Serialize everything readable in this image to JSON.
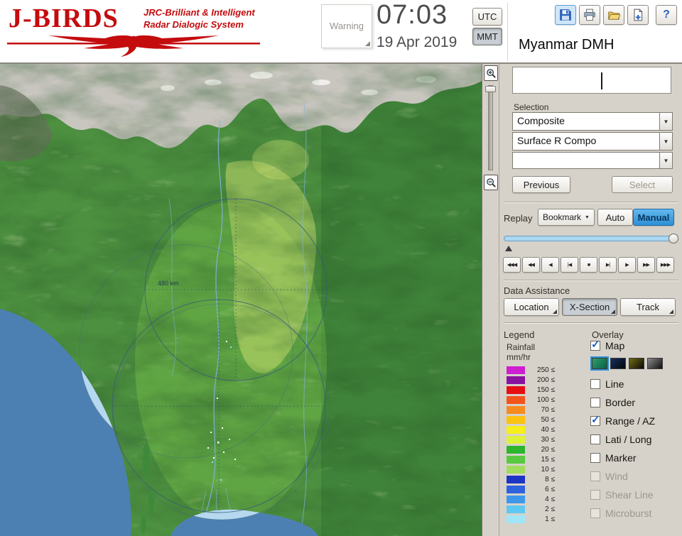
{
  "glyphs": {
    "down_arrow": "▼",
    "check": "✓",
    "help": "?"
  },
  "header": {
    "logo": {
      "title": "J-BIRDS",
      "subtitle_line1": "JRC-Brilliant & Intelligent",
      "subtitle_line2": "Radar  Dialogic  System"
    },
    "warning_label": "Warning",
    "clock": {
      "time": "07:03",
      "date": "19 Apr 2019"
    },
    "timezone": {
      "utc": "UTC",
      "mmt": "MMT",
      "selected": "MMT"
    },
    "station_name": "Myanmar DMH"
  },
  "map": {
    "range_label": "480 km"
  },
  "panel": {
    "selection_label": "Selection",
    "combo_product": "Composite",
    "combo_surface": "Surface R Compo",
    "combo_extra": "",
    "previous_button": "Previous",
    "select_button": "Select",
    "replay": {
      "label": "Replay",
      "bookmark_button": "Bookmark",
      "auto_button": "Auto",
      "manual_button": "Manual",
      "active_mode": "Manual",
      "playback": [
        {
          "name": "jump-back",
          "glyph": "◀◀◀"
        },
        {
          "name": "fast-rewind",
          "glyph": "◀◀"
        },
        {
          "name": "play-reverse",
          "glyph": "◀"
        },
        {
          "name": "step-back",
          "glyph": "|◀"
        },
        {
          "name": "stop",
          "glyph": "■"
        },
        {
          "name": "step-forward",
          "glyph": "▶|"
        },
        {
          "name": "play",
          "glyph": "▶"
        },
        {
          "name": "fast-forward",
          "glyph": "▶▶"
        },
        {
          "name": "jump-forward",
          "glyph": "▶▶▶"
        }
      ]
    },
    "data_assistance": {
      "label": "Data Assistance",
      "buttons": [
        "Location",
        "X-Section",
        "Track"
      ]
    },
    "legend": {
      "label": "Legend",
      "unit_line1": "Rainfall",
      "unit_line2": "mm/hr",
      "scale": [
        {
          "value": "250 ≤",
          "color": "#ce1ed2"
        },
        {
          "value": "200 ≤",
          "color": "#8a12a0"
        },
        {
          "value": "150 ≤",
          "color": "#e60f12"
        },
        {
          "value": "100 ≤",
          "color": "#f3541b"
        },
        {
          "value": "70 ≤",
          "color": "#f68b1f"
        },
        {
          "value": "50 ≤",
          "color": "#fbc210"
        },
        {
          "value": "40 ≤",
          "color": "#f6ef19"
        },
        {
          "value": "30 ≤",
          "color": "#dff23a"
        },
        {
          "value": "20 ≤",
          "color": "#2eb52e"
        },
        {
          "value": "15 ≤",
          "color": "#58c940"
        },
        {
          "value": "10 ≤",
          "color": "#a2dc5c"
        },
        {
          "value": "8 ≤",
          "color": "#1d35c4"
        },
        {
          "value": "6 ≤",
          "color": "#2e63dd"
        },
        {
          "value": "4 ≤",
          "color": "#3e97ea"
        },
        {
          "value": "2 ≤",
          "color": "#5fc8f2"
        },
        {
          "value": "1 ≤",
          "color": "#a0e6f8"
        }
      ]
    },
    "overlay": {
      "label": "Overlay",
      "map_swatches": [
        {
          "name": "terrain-style",
          "from": "#2f9e6e",
          "to": "#0a5f46",
          "selected": true
        },
        {
          "name": "dark-blue-style",
          "from": "#14305e",
          "to": "#05060a",
          "selected": false
        },
        {
          "name": "olive-style",
          "from": "#6f6a16",
          "to": "#0a0a05",
          "selected": false
        },
        {
          "name": "gray-style",
          "from": "#8a8a8a",
          "to": "#101010",
          "selected": false
        }
      ],
      "items": [
        {
          "label": "Map",
          "checked": true,
          "enabled": true
        },
        {
          "label": "Line",
          "checked": false,
          "enabled": true
        },
        {
          "label": "Border",
          "checked": false,
          "enabled": true
        },
        {
          "label": "Range / AZ",
          "checked": true,
          "enabled": true
        },
        {
          "label": "Lati / Long",
          "checked": false,
          "enabled": true
        },
        {
          "label": "Marker",
          "checked": false,
          "enabled": true
        },
        {
          "label": "Wind",
          "checked": false,
          "enabled": false
        },
        {
          "label": "Shear Line",
          "checked": false,
          "enabled": false
        },
        {
          "label": "Microburst",
          "checked": false,
          "enabled": false
        }
      ]
    }
  },
  "colors": {
    "accent_blue": "#2f90d8",
    "sea": "#4d80b2",
    "logo_red": "#c40b0e"
  }
}
